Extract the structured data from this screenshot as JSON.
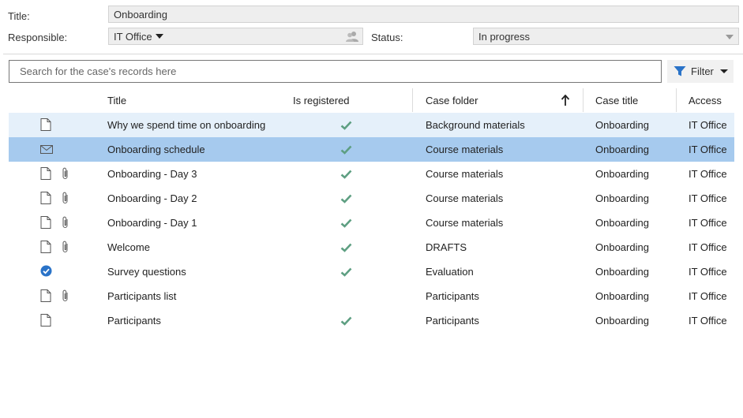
{
  "header": {
    "title_label": "Title:",
    "title_value": "Onboarding",
    "responsible_label": "Responsible:",
    "responsible_value": "IT Office",
    "status_label": "Status:",
    "status_value": "In progress"
  },
  "search": {
    "placeholder": "Search for the case's records here"
  },
  "filter": {
    "label": "Filter"
  },
  "columns": {
    "title": "Title",
    "registered": "Is registered",
    "folder": "Case folder",
    "case_title": "Case title",
    "access": "Access"
  },
  "sort": {
    "column": "Case folder",
    "direction": "ascending",
    "icon": "arrow-up-icon"
  },
  "colors": {
    "accent": "#2a73c8",
    "check": "#5e9f82",
    "hover_row": "#e5f0fa",
    "selected_row": "#a6caee"
  },
  "rows": [
    {
      "type": "document",
      "attachment": false,
      "title": "Why we spend time on onboarding",
      "registered": true,
      "folder": "Background materials",
      "case_title": "Onboarding",
      "access": "IT Office",
      "state": "hover"
    },
    {
      "type": "email",
      "attachment": false,
      "title": "Onboarding schedule",
      "registered": true,
      "folder": "Course materials",
      "case_title": "Onboarding",
      "access": "IT Office",
      "state": "selected"
    },
    {
      "type": "document",
      "attachment": true,
      "title": "Onboarding - Day 3",
      "registered": true,
      "folder": "Course materials",
      "case_title": "Onboarding",
      "access": "IT Office",
      "state": ""
    },
    {
      "type": "document",
      "attachment": true,
      "title": "Onboarding - Day 2",
      "registered": true,
      "folder": "Course materials",
      "case_title": "Onboarding",
      "access": "IT Office",
      "state": ""
    },
    {
      "type": "document",
      "attachment": true,
      "title": "Onboarding - Day 1",
      "registered": true,
      "folder": "Course materials",
      "case_title": "Onboarding",
      "access": "IT Office",
      "state": ""
    },
    {
      "type": "document",
      "attachment": true,
      "title": "Welcome",
      "registered": true,
      "folder": "DRAFTS",
      "case_title": "Onboarding",
      "access": "IT Office",
      "state": ""
    },
    {
      "type": "survey",
      "attachment": false,
      "title": "Survey questions",
      "registered": true,
      "folder": "Evaluation",
      "case_title": "Onboarding",
      "access": "IT Office",
      "state": ""
    },
    {
      "type": "document",
      "attachment": true,
      "title": "Participants list",
      "registered": false,
      "folder": "Participants",
      "case_title": "Onboarding",
      "access": "IT Office",
      "state": ""
    },
    {
      "type": "document",
      "attachment": false,
      "title": "Participants",
      "registered": true,
      "folder": "Participants",
      "case_title": "Onboarding",
      "access": "IT Office",
      "state": ""
    }
  ]
}
